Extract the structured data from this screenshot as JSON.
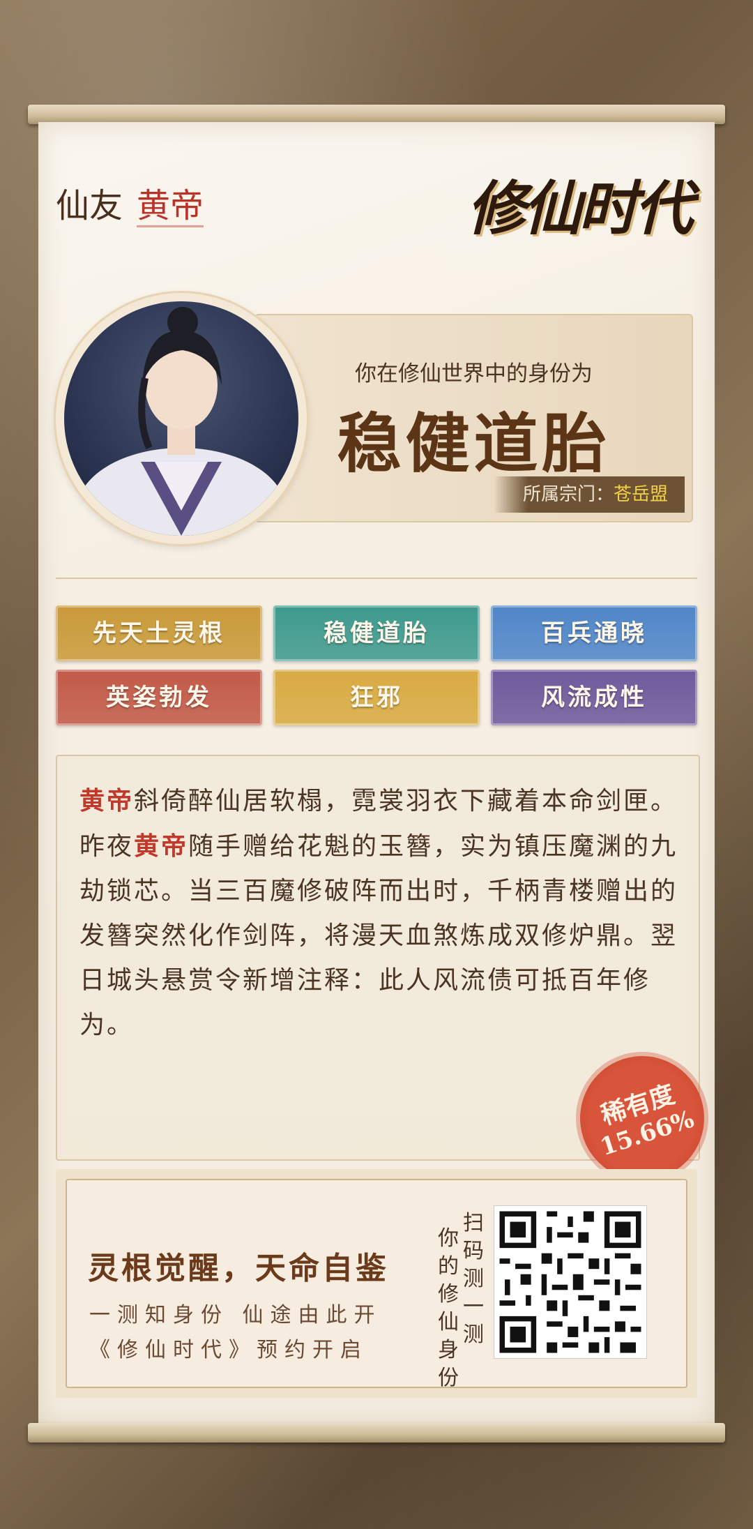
{
  "header": {
    "friend_prefix": "仙友",
    "friend_name": "黄帝",
    "logo": "修仙时代"
  },
  "identity": {
    "prompt": "你在修仙世界中的身份为",
    "title": "稳健道胎",
    "sect_label": "所属宗门：",
    "sect_value": "苍岳盟"
  },
  "tags": [
    {
      "label": "先天土灵根",
      "color": "#c99a3a"
    },
    {
      "label": "稳健道胎",
      "color": "#3e9a8e"
    },
    {
      "label": "百兵通晓",
      "color": "#4f86c8"
    },
    {
      "label": "英姿勃发",
      "color": "#c25a48"
    },
    {
      "label": "狂邪",
      "color": "#d8aa42"
    },
    {
      "label": "风流成性",
      "color": "#6f5a9c"
    }
  ],
  "description": {
    "name": "黄帝",
    "part1": "斜倚醉仙居软榻，霓裳羽衣下藏着本命剑匣。昨夜",
    "part2": "随手赠给花魁的玉簪，实为镇压魔渊的九劫锁芯。当三百魔修破阵而出时，千柄青楼赠出的发簪突然化作剑阵，将漫天血煞炼成双修炉鼎。翌日城头悬赏令新增注释：此人风流债可抵百年修为。"
  },
  "rarity": {
    "label": "稀有度",
    "value": "15.66%"
  },
  "promo": {
    "slogan": "灵根觉醒，天命自鉴",
    "line1": "一测知身份 仙途由此开",
    "line2": "《修仙时代》预约开启",
    "scan_col1": "扫码测一测",
    "scan_col2": "你的修仙身份"
  }
}
